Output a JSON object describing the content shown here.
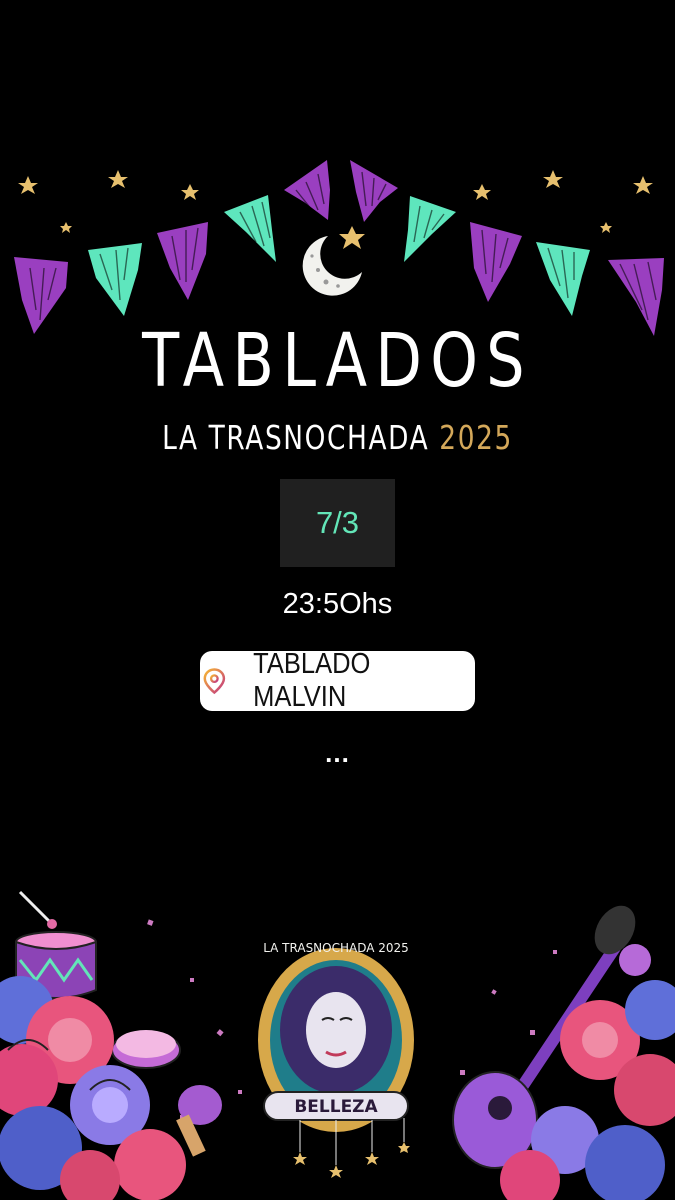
{
  "story": {
    "title": "TABLADOS",
    "subtitle_text": "LA TRASNOCHADA",
    "subtitle_year": "2025",
    "date_sticker": "7/3",
    "time_text": "23:5Ohs",
    "location_sticker": "TABLADO MALVIN",
    "more_text": "...",
    "emblem_arc_text": "LA TRASNOCHADA 2025",
    "emblem_banner_text": "BELLEZA"
  },
  "icons": {
    "location": "map-pin-icon",
    "moon": "crescent-moon-icon",
    "star": "star-icon"
  },
  "colors": {
    "background": "#000000",
    "purple": "#9a3fc0",
    "teal": "#5ee6bd",
    "gold": "#e7c06e",
    "date_text": "#63e6b8",
    "year": "#d4a85a",
    "pin_gradient_start": "#f7b733",
    "pin_gradient_end": "#c13584"
  }
}
